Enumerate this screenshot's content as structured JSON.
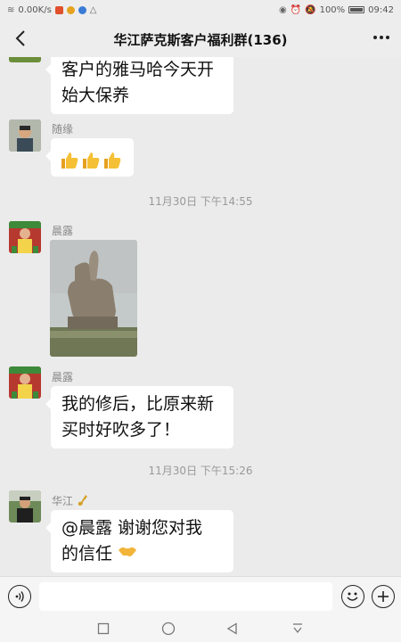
{
  "status_bar": {
    "net_speed": "0.00K/s",
    "battery": "100%",
    "time": "09:42"
  },
  "header": {
    "title": "华江萨克斯客户福利群(136)"
  },
  "messages": {
    "m1": {
      "text_line1": "客户的雅马哈今天开",
      "text_line2": "始大保养"
    },
    "m2": {
      "sender": "随缘"
    },
    "t1": "11月30日  下午14:55",
    "m3": {
      "sender": "晨露"
    },
    "m4": {
      "sender": "晨露",
      "text_line1": "我的修后，比原来新",
      "text_line2": "买时好吹多了！"
    },
    "t2": "11月30日  下午15:26",
    "m5": {
      "sender": "华江",
      "text_line1": "@晨露   谢谢您对我",
      "text_line2": "的信任"
    }
  },
  "icons": {
    "back": "back-arrow-icon",
    "more": "more-dots-icon",
    "voice": "voice-icon",
    "emoji": "emoji-icon",
    "plus": "plus-icon",
    "thumb": "thumbs-up-emoji",
    "handshake": "handshake-emoji",
    "saxophone": "saxophone-emoji"
  },
  "colors": {
    "chat_bg": "#ebebeb",
    "bubble": "#ffffff",
    "text": "#111111",
    "muted": "#888888"
  }
}
